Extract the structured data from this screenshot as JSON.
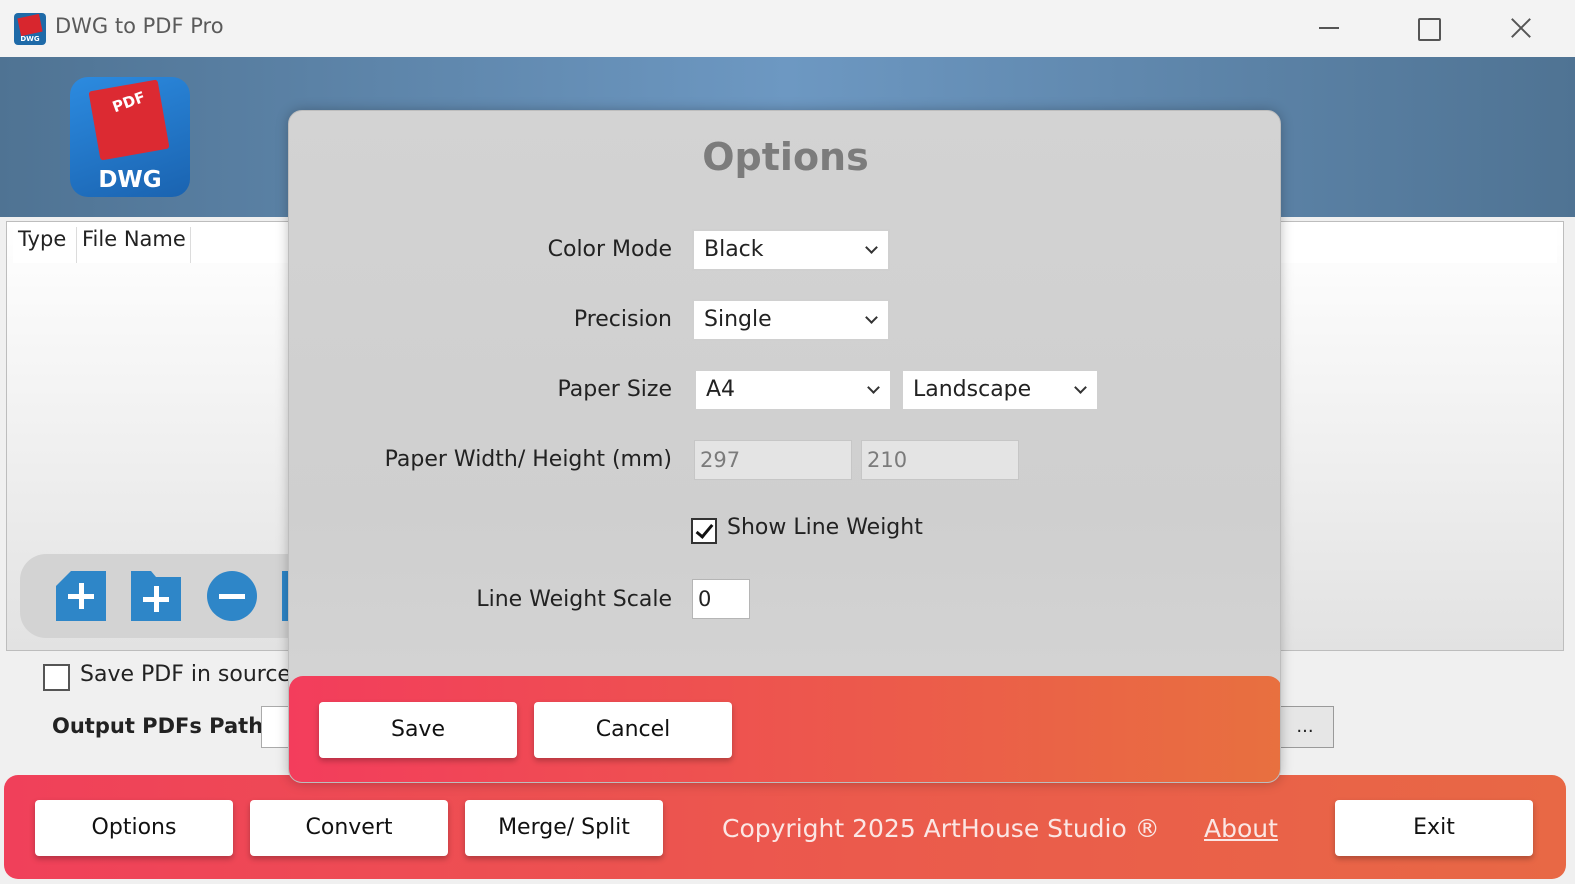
{
  "window": {
    "title": "DWG to PDF Pro",
    "app_icon_label": "DWG"
  },
  "header": {
    "logo_top_text": "PDF",
    "logo_label": "DWG"
  },
  "file_list": {
    "columns": [
      "Type",
      "File Name"
    ]
  },
  "source_option": {
    "label": "Save PDF in source",
    "checked": false
  },
  "output": {
    "label": "Output PDFs Path:",
    "value": "",
    "browse_label": "..."
  },
  "bottom_bar": {
    "options_label": "Options",
    "convert_label": "Convert",
    "merge_label": "Merge/ Split",
    "copyright": "Copyright 2025 ArtHouse Studio ®",
    "about_label": "About",
    "exit_label": "Exit"
  },
  "dialog": {
    "title": "Options",
    "color_mode": {
      "label": "Color Mode",
      "value": "Black"
    },
    "precision": {
      "label": "Precision",
      "value": "Single"
    },
    "paper_size": {
      "label": "Paper Size",
      "value": "A4",
      "orientation": "Landscape"
    },
    "paper_dims": {
      "label": "Paper Width/ Height (mm)",
      "width": "297",
      "height": "210"
    },
    "show_line_weight": {
      "label": "Show Line Weight",
      "checked": true
    },
    "line_weight_scale": {
      "label": "Line Weight Scale",
      "value": "0"
    },
    "save_label": "Save",
    "cancel_label": "Cancel"
  },
  "colors": {
    "accent_red": "#f0405a",
    "accent_orange": "#e86845",
    "toolbar_blue": "#2e86c8",
    "header_blue": "#5d86ad"
  },
  "icons": [
    "add-file-icon",
    "add-folder-icon",
    "remove-icon"
  ]
}
